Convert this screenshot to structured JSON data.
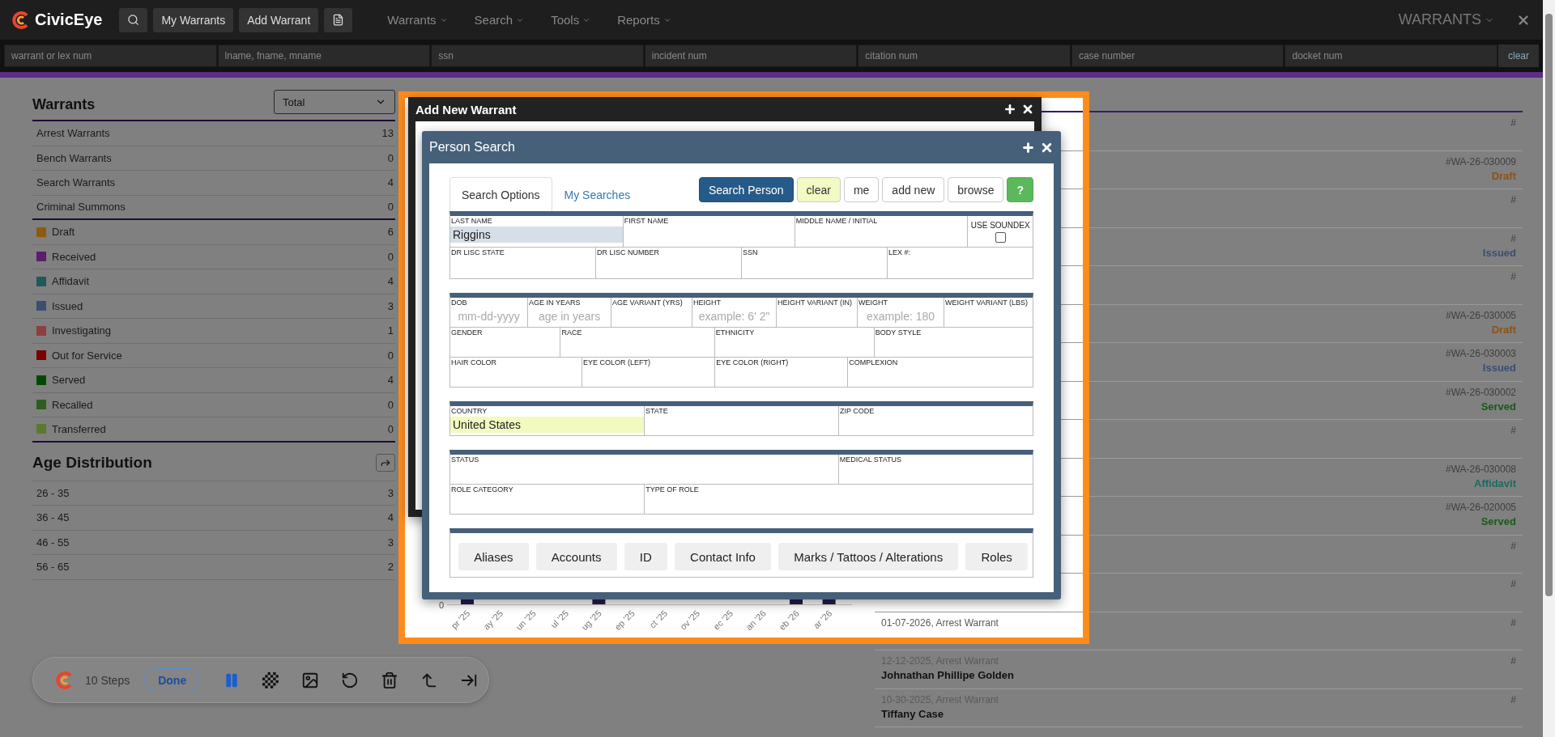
{
  "nav": {
    "logo": "CivicEye",
    "quick_buttons": [
      "My Warrants",
      "Add Warrant"
    ],
    "menus": [
      {
        "label": "Warrants"
      },
      {
        "label": "Search"
      },
      {
        "label": "Tools"
      },
      {
        "label": "Reports"
      }
    ],
    "module": "WARRANTS"
  },
  "filters": {
    "placeholders": [
      "warrant or lex num",
      "lname, fname, mname",
      "ssn",
      "incident num",
      "citation num",
      "case number",
      "docket num"
    ],
    "clear": "clear"
  },
  "summary": {
    "title": "Warrants",
    "select": "Total",
    "types": [
      {
        "label": "Arrest Warrants",
        "count": "13"
      },
      {
        "label": "Bench Warrants",
        "count": "0"
      },
      {
        "label": "Search Warrants",
        "count": "4"
      },
      {
        "label": "Criminal Summons",
        "count": "0"
      }
    ],
    "statuses": [
      {
        "label": "Draft",
        "count": "6",
        "color": "#8e5a0e"
      },
      {
        "label": "Received",
        "count": "0",
        "color": "#5a1e6a"
      },
      {
        "label": "Affidavit",
        "count": "4",
        "color": "#1e5a5a"
      },
      {
        "label": "Issued",
        "count": "3",
        "color": "#3a5070"
      },
      {
        "label": "Investigating",
        "count": "1",
        "color": "#8a4040"
      },
      {
        "label": "Out for Service",
        "count": "0",
        "color": "#7a0000"
      },
      {
        "label": "Served",
        "count": "4",
        "color": "#004a00"
      },
      {
        "label": "Recalled",
        "count": "0",
        "color": "#2e5e1e"
      },
      {
        "label": "Transferred",
        "count": "0",
        "color": "#5a7a2e"
      }
    ]
  },
  "age_distribution": {
    "title": "Age Distribution",
    "rows": [
      {
        "label": "26 - 35",
        "count": "3"
      },
      {
        "label": "36 - 45",
        "count": "4"
      },
      {
        "label": "46 - 55",
        "count": "3"
      },
      {
        "label": "56 - 65",
        "count": "2"
      }
    ]
  },
  "chart_fragment": {
    "y_tick": "0",
    "x_labels": [
      "pr '25",
      "ay '25",
      "un '25",
      "ul '25",
      "ug '25",
      "ep '25",
      "ct '25",
      "ov '25",
      "ec '25",
      "an '26",
      "eb '26",
      "ar '26"
    ]
  },
  "recent": [
    {
      "id": "#"
    },
    {
      "id": "#WA-26-030009",
      "status": "Draft",
      "color": "#8a5418"
    },
    {
      "id": "#"
    },
    {
      "id": "#",
      "status": "Issued",
      "color": "#3a5070"
    },
    {
      "id": "#"
    },
    {
      "id": "#WA-26-030005",
      "status": "Draft",
      "color": "#8a5418"
    },
    {
      "id": "#WA-26-030003",
      "status": "Issued",
      "color": "#3a5070"
    },
    {
      "id": "#WA-26-030002",
      "status": "Served",
      "color": "#185a18"
    },
    {
      "id": "#"
    },
    {
      "id": "#WA-26-030008",
      "status": "Affidavit",
      "color": "#1e6a62"
    },
    {
      "id": "#WA-26-020005",
      "status": "Served",
      "color": "#185a18"
    },
    {
      "id": "#"
    },
    {
      "id": "#"
    },
    {
      "id": "#",
      "date": "01-07-2026, Arrest Warrant"
    },
    {
      "id": "#",
      "date": "12-12-2025, Arrest Warrant",
      "name": "Johnathan Phillipe Golden"
    },
    {
      "id": "#",
      "date": "10-30-2025, Arrest Warrant",
      "name": "Tiffany Case"
    }
  ],
  "add_warrant": {
    "title": "Add New Warrant"
  },
  "person_search": {
    "title": "Person Search",
    "tabs": [
      {
        "label": "Search Options",
        "selected": true
      },
      {
        "label": "My Searches",
        "selected": false
      }
    ],
    "actions": [
      {
        "label": "Search Person",
        "kind": "primary"
      },
      {
        "label": "clear",
        "kind": "warning"
      },
      {
        "label": "me",
        "kind": "default"
      },
      {
        "label": "add new",
        "kind": "default"
      },
      {
        "label": "browse",
        "kind": "default"
      },
      {
        "label": "?",
        "kind": "success"
      }
    ],
    "sections": [
      [
        [
          {
            "label": "LAST NAME",
            "kind": "active",
            "value": "Riggins"
          },
          {
            "label": "FIRST NAME",
            "kind": "input"
          },
          {
            "label": "MIDDLE NAME / INITIAL",
            "kind": "input"
          },
          {
            "label": "USE SOUNDEX",
            "kind": "checkbox",
            "checked": false
          }
        ],
        [
          {
            "label": "DR LISC STATE",
            "kind": "input"
          },
          {
            "label": "DR LISC NUMBER",
            "kind": "input"
          },
          {
            "label": "SSN",
            "kind": "input"
          },
          {
            "label": "LEX #:",
            "kind": "input"
          }
        ]
      ],
      [
        [
          {
            "label": "DOB",
            "kind": "input",
            "placeholder": "mm-dd-yyyy"
          },
          {
            "label": "AGE IN YEARS",
            "kind": "input",
            "placeholder": "age in years"
          },
          {
            "label": "AGE VARIANT (YRS)",
            "kind": "input"
          },
          {
            "label": "HEIGHT",
            "kind": "input",
            "placeholder": "example: 6' 2\""
          },
          {
            "label": "HEIGHT VARIANT (IN)",
            "kind": "input"
          },
          {
            "label": "WEIGHT",
            "kind": "input",
            "placeholder": "example: 180"
          },
          {
            "label": "WEIGHT VARIANT (LBS)",
            "kind": "input"
          }
        ],
        [
          {
            "label": "GENDER",
            "kind": "input"
          },
          {
            "label": "RACE",
            "kind": "input"
          },
          {
            "label": "ETHNICITY",
            "kind": "input"
          },
          {
            "label": "BODY STYLE",
            "kind": "input"
          }
        ],
        [
          {
            "label": "HAIR COLOR",
            "kind": "input"
          },
          {
            "label": "EYE COLOR (LEFT)",
            "kind": "input"
          },
          {
            "label": "EYE COLOR (RIGHT)",
            "kind": "input"
          },
          {
            "label": "COMPLEXION",
            "kind": "input"
          }
        ]
      ],
      [
        [
          {
            "label": "COUNTRY",
            "kind": "prefilled",
            "value": "United States"
          },
          {
            "label": "STATE",
            "kind": "input"
          },
          {
            "label": "ZIP CODE",
            "kind": "input"
          }
        ]
      ],
      [
        [
          {
            "label": "STATUS",
            "kind": "input"
          },
          {
            "label": "MEDICAL STATUS",
            "kind": "input"
          }
        ],
        [
          {
            "label": "ROLE CATEGORY",
            "kind": "input"
          },
          {
            "label": "TYPE OF ROLE",
            "kind": "input"
          }
        ]
      ]
    ],
    "detail_buttons": [
      "Aliases",
      "Accounts",
      "ID",
      "Contact Info",
      "Marks / Tattoos / Alterations",
      "Roles"
    ]
  },
  "recorder": {
    "steps": "10 Steps",
    "done": "Done"
  }
}
